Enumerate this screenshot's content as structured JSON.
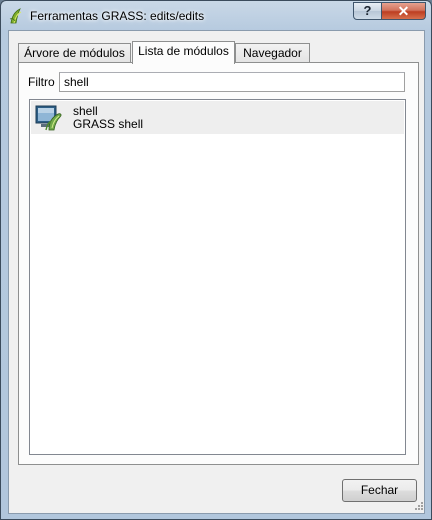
{
  "window": {
    "title": "Ferramentas GRASS: edits/edits",
    "app_icon": "grass-icon",
    "help_button": "?",
    "close_button": "✕"
  },
  "tabs": [
    {
      "label": "Árvore de módulos",
      "active": false
    },
    {
      "label": "Lista de módulos",
      "active": true
    },
    {
      "label": "Navegador",
      "active": false
    }
  ],
  "filter": {
    "label": "Filtro",
    "value": "shell"
  },
  "modules": [
    {
      "name": "shell",
      "description": "GRASS shell",
      "icon": "grass-shell-icon",
      "selected": true
    }
  ],
  "footer": {
    "close_label": "Fechar"
  },
  "colors": {
    "titlebar": "#b8cbe0",
    "close_button": "#c9452a",
    "selection": "#eeeeee"
  }
}
